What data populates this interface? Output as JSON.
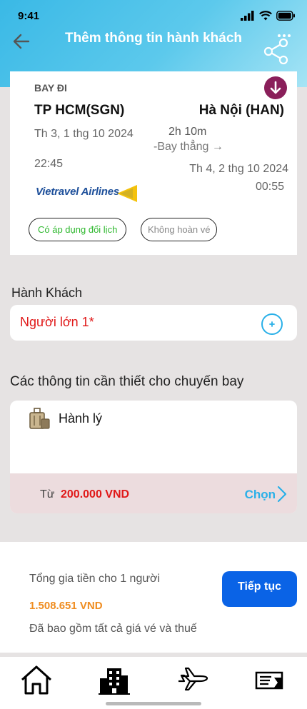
{
  "status_bar": {
    "time": "9:41"
  },
  "header": {
    "title": "Thêm thông tin hành khách",
    "back_icon": "arrow-left-icon",
    "share_icon": "share-icon",
    "menu_icon": "more-dots-icon"
  },
  "flight": {
    "direction_label": "BAY ĐI",
    "from": "TP HCM(SGN)",
    "to": "Hà Nội (HAN)",
    "departure_date": "Th 3, 1 thg 10 2024",
    "departure_time": "22:45",
    "duration": "2h 10m",
    "stops": "-Bay thẳng →",
    "arrival_date": "Th 4, 2 thg 10 2024",
    "arrival_time": "00:55",
    "airline": "Vietravel Airlines",
    "tags": [
      "Có áp dụng đổi lịch",
      "Không hoàn vé"
    ],
    "accent_color": "#8a1f5a"
  },
  "passengers": {
    "section_title": "Hành Khách",
    "items": [
      {
        "label": "Người lớn 1*"
      }
    ]
  },
  "flight_info": {
    "section_title": "Các thông tin cần thiết cho chuyến bay",
    "baggage": {
      "label": "Hành lý",
      "price_prefix": "Từ",
      "price": "200.000 VND",
      "action": "Chọn"
    }
  },
  "summary": {
    "total_label": "Tổng gia tiền cho 1 người",
    "total_value": "1.508.651 VND",
    "note": "Đã bao gồm tất cả giá vé và thuế",
    "continue_label": "Tiếp tục",
    "brand_color": "#0a63e6",
    "price_color": "#ef8c1f"
  },
  "tabbar": {
    "items": [
      "home-icon",
      "hotel-icon",
      "plane-icon",
      "ticket-icon"
    ]
  }
}
